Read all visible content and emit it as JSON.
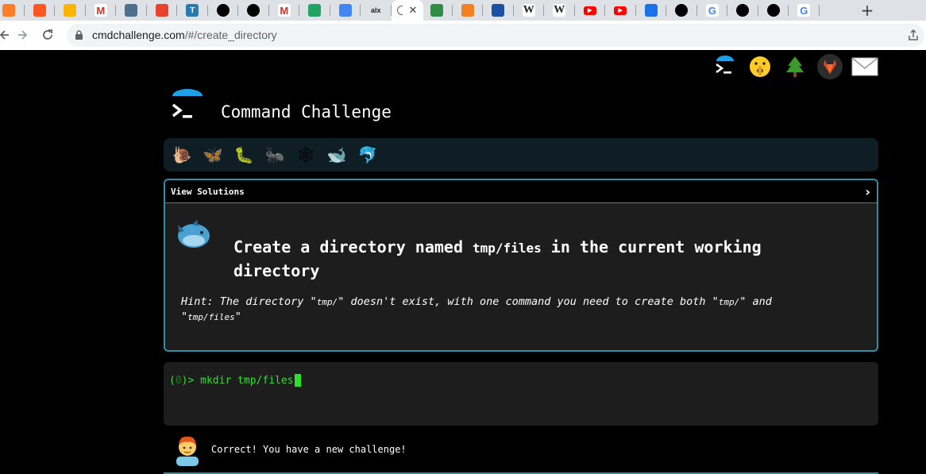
{
  "browser": {
    "tabs": [
      {
        "icon": "box-icon",
        "label": "",
        "color": "#ff7f27"
      },
      {
        "icon": "zoho-icon",
        "label": "",
        "color": "#ff5722"
      },
      {
        "icon": "airtable-icon",
        "label": "",
        "color": "#fcb400"
      },
      {
        "icon": "gmail-icon",
        "label": "M",
        "color": "#d93025"
      },
      {
        "icon": "pyramid-icon",
        "label": "",
        "color": "#4f6f8f"
      },
      {
        "icon": "lightning-icon",
        "label": "",
        "color": "#e8432e"
      },
      {
        "icon": "t-icon",
        "label": "T",
        "color": "#2a7ab0"
      },
      {
        "icon": "github-icon",
        "label": "",
        "color": "#000000"
      },
      {
        "icon": "github-icon",
        "label": "",
        "color": "#000000"
      },
      {
        "icon": "gmail-icon",
        "label": "M",
        "color": "#d93025"
      },
      {
        "icon": "drive-icon",
        "label": "",
        "color": "#1fa463"
      },
      {
        "icon": "docs-icon",
        "label": "",
        "color": "#4285f4"
      },
      {
        "icon": "alx-icon",
        "label": "alx",
        "color": "#222222"
      },
      {
        "icon": "cmdchallenge-icon",
        "label": "",
        "color": "#202124",
        "active": true
      },
      {
        "icon": "geeksforgeeks-icon",
        "label": "",
        "color": "#2f8d46"
      },
      {
        "icon": "stackoverflow-icon",
        "label": "",
        "color": "#f48024"
      },
      {
        "icon": "bluebox-icon",
        "label": "",
        "color": "#1a4fa3"
      },
      {
        "icon": "wikipedia-icon",
        "label": "W",
        "color": "#222222"
      },
      {
        "icon": "wikipedia-icon",
        "label": "W",
        "color": "#222222"
      },
      {
        "icon": "youtube-icon",
        "label": "",
        "color": "#ff0000"
      },
      {
        "icon": "youtube-icon",
        "label": "",
        "color": "#ff0000"
      },
      {
        "icon": "download-icon",
        "label": "",
        "color": "#1a73e8"
      },
      {
        "icon": "github-icon",
        "label": "",
        "color": "#000000"
      },
      {
        "icon": "google-icon",
        "label": "G",
        "color": "#4285f4"
      },
      {
        "icon": "github-icon",
        "label": "",
        "color": "#000000"
      },
      {
        "icon": "github-icon",
        "label": "",
        "color": "#000000"
      },
      {
        "icon": "google-icon",
        "label": "G",
        "color": "#4285f4"
      }
    ],
    "close_glyph": "✕",
    "new_tab_glyph": "+",
    "url_host": "cmdchallenge.com",
    "url_path": "/#/create_directory"
  },
  "header": {
    "title": "Command Challenge",
    "top_icons": [
      "terminal-icon",
      "shushing-face-icon",
      "tree-icon",
      "gitlab-icon",
      "envelope-icon"
    ]
  },
  "levels": {
    "items": [
      {
        "icon": "snail-icon",
        "glyph": "🐌"
      },
      {
        "icon": "butterfly-icon",
        "glyph": "🦋"
      },
      {
        "icon": "caterpillar-icon",
        "glyph": "🐛"
      },
      {
        "icon": "ant-icon",
        "glyph": "🐜"
      },
      {
        "icon": "spider-web-icon",
        "glyph": "🕸"
      },
      {
        "icon": "whale-icon",
        "glyph": "🐋"
      },
      {
        "icon": "dolphin-icon",
        "glyph": "🐬"
      }
    ]
  },
  "challenge": {
    "view_solutions_label": "View Solutions",
    "chevron": "›",
    "text_before": "Create a directory named ",
    "code": "tmp/files",
    "text_after": " in the current working directory",
    "hint_prefix": "Hint: The directory \"",
    "hint_code1": "tmp/",
    "hint_mid": "\" doesn't exist, with one command you need to create both \"",
    "hint_code2": "tmp/",
    "hint_and": "\" and \"",
    "hint_code3": "tmp/files",
    "hint_end": "\""
  },
  "terminal": {
    "prompt_open": "(",
    "prompt_num": "0",
    "prompt_close": ")>",
    "command": "mkdir tmp/files"
  },
  "feedback": {
    "message": "Correct! You have a new challenge!"
  }
}
